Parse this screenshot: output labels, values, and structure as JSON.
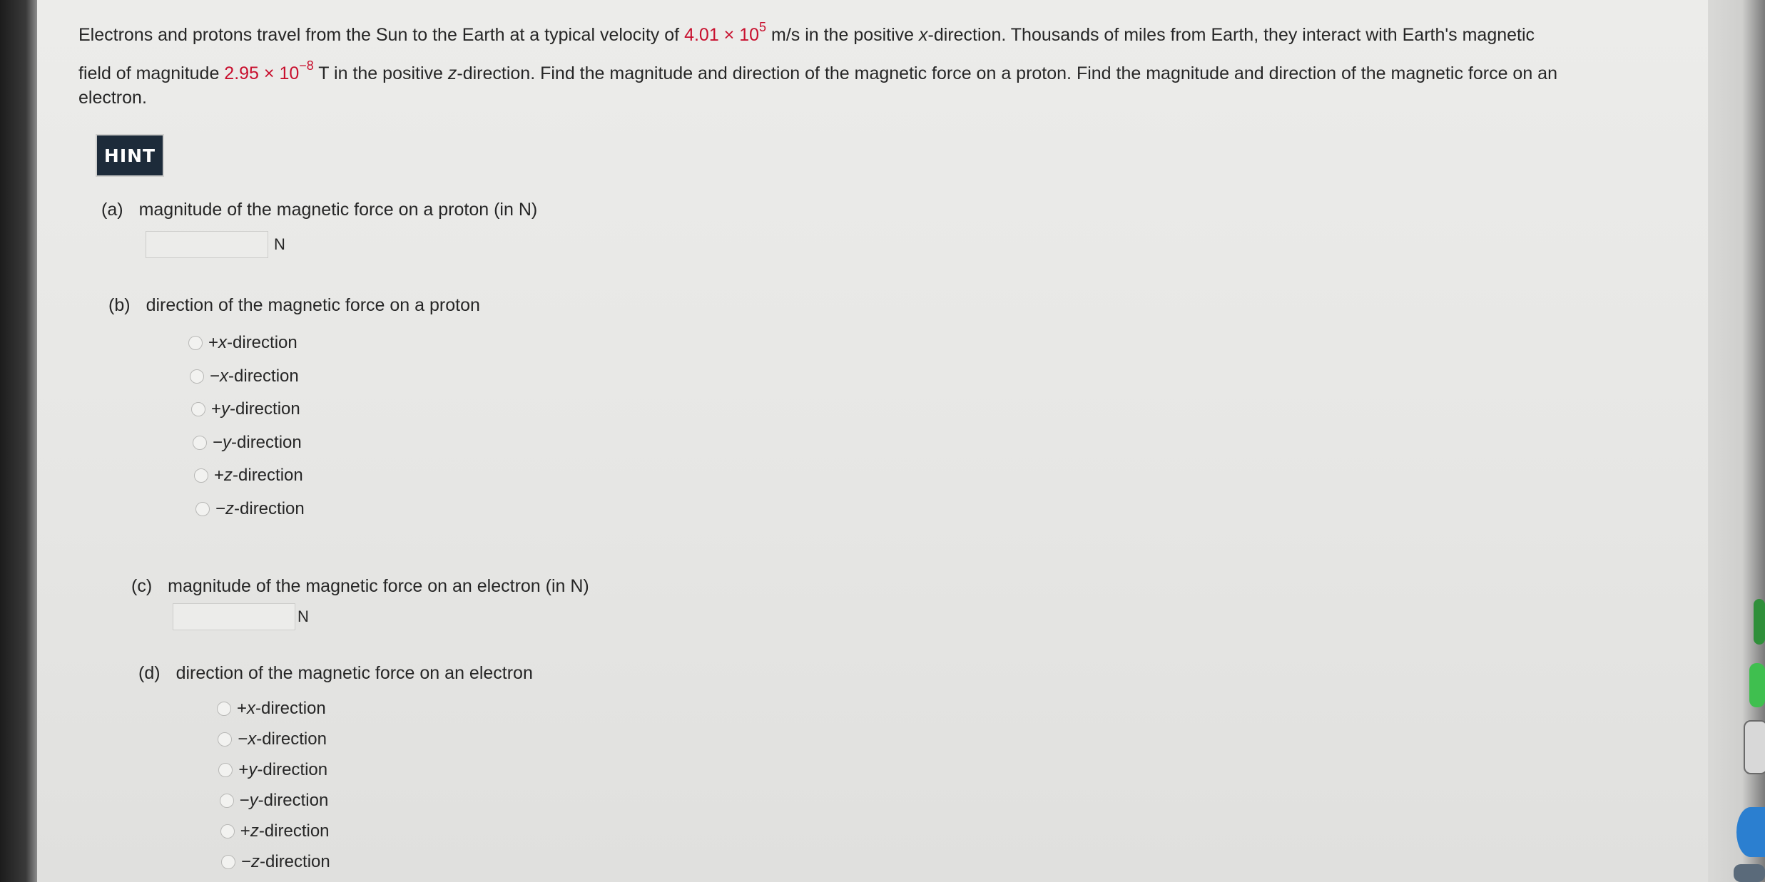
{
  "problem": {
    "t1": "Electrons and protons travel from the Sun to the Earth at a typical velocity of ",
    "velocity_mantissa": "4.01 × 10",
    "velocity_exp": "5",
    "t2": " m/s in the positive ",
    "x_var": "x",
    "t3": "-direction. Thousands of miles from Earth, they interact with Earth's magnetic",
    "t4": "field of magnitude ",
    "field_mantissa": "2.95 × 10",
    "field_exp": "−8",
    "t5": " T in the positive ",
    "z_var": "z",
    "t6": "-direction. Find the magnitude and direction of the magnetic force on a proton. Find the magnitude and direction of the magnetic force on an",
    "t7": "electron."
  },
  "hint_label": "HINT",
  "parts": {
    "a": {
      "letter": "(a)",
      "text": "magnitude of the magnetic force on a proton (in N)",
      "unit": "N",
      "value": ""
    },
    "b": {
      "letter": "(b)",
      "text": "direction of the magnetic force on a proton"
    },
    "c": {
      "letter": "(c)",
      "text": "magnitude of the magnetic force on an electron (in N)",
      "unit": "N",
      "value": ""
    },
    "d": {
      "letter": "(d)",
      "text": "direction of the magnetic force on an electron"
    }
  },
  "options": [
    {
      "sign": "+",
      "axis": "x",
      "suffix": "-direction"
    },
    {
      "sign": "−",
      "axis": "x",
      "suffix": "-direction"
    },
    {
      "sign": "+",
      "axis": "y",
      "suffix": "-direction"
    },
    {
      "sign": "−",
      "axis": "y",
      "suffix": "-direction"
    },
    {
      "sign": "+",
      "axis": "z",
      "suffix": "-direction"
    },
    {
      "sign": "−",
      "axis": "z",
      "suffix": "-direction"
    }
  ],
  "colors": {
    "given_value_red": "#c8102e",
    "hint_background": "#1d2b3a"
  }
}
